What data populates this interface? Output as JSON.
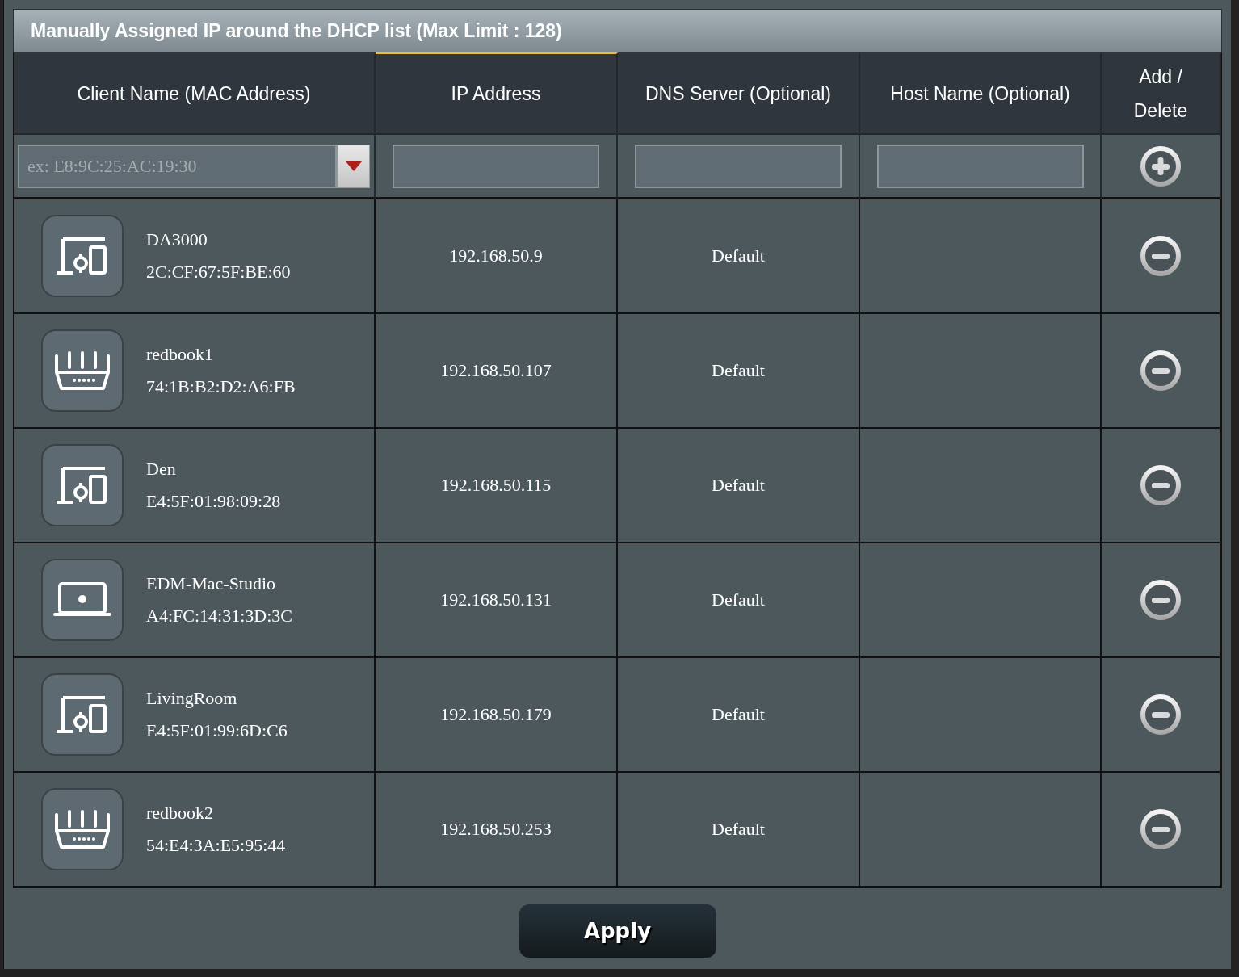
{
  "title": "Manually Assigned IP around the DHCP list (Max Limit : 128)",
  "columns": [
    {
      "label": "Client Name (MAC Address)",
      "sorted": false
    },
    {
      "label": "IP Address",
      "sorted": true
    },
    {
      "label": "DNS Server (Optional)",
      "sorted": false
    },
    {
      "label": "Host Name (Optional)",
      "sorted": false
    },
    {
      "label": "Add / Delete",
      "sorted": false
    }
  ],
  "new_entry": {
    "mac_placeholder": "ex: E8:9C:25:AC:19:30"
  },
  "rows": [
    {
      "kind": "media",
      "name": "DA3000",
      "mac": "2C:CF:67:5F:BE:60",
      "ip": "192.168.50.9",
      "dns": "Default"
    },
    {
      "kind": "router",
      "name": "redbook1",
      "mac": "74:1B:B2:D2:A6:FB",
      "ip": "192.168.50.107",
      "dns": "Default"
    },
    {
      "kind": "media",
      "name": "Den",
      "mac": "E4:5F:01:98:09:28",
      "ip": "192.168.50.115",
      "dns": "Default"
    },
    {
      "kind": "laptop",
      "name": "EDM-Mac-Studio",
      "mac": "A4:FC:14:31:3D:3C",
      "ip": "192.168.50.131",
      "dns": "Default"
    },
    {
      "kind": "media",
      "name": "LivingRoom",
      "mac": "E4:5F:01:99:6D:C6",
      "ip": "192.168.50.179",
      "dns": "Default"
    },
    {
      "kind": "router",
      "name": "redbook2",
      "mac": "54:E4:3A:E5:95:44",
      "ip": "192.168.50.253",
      "dns": "Default"
    }
  ],
  "apply": "Apply"
}
